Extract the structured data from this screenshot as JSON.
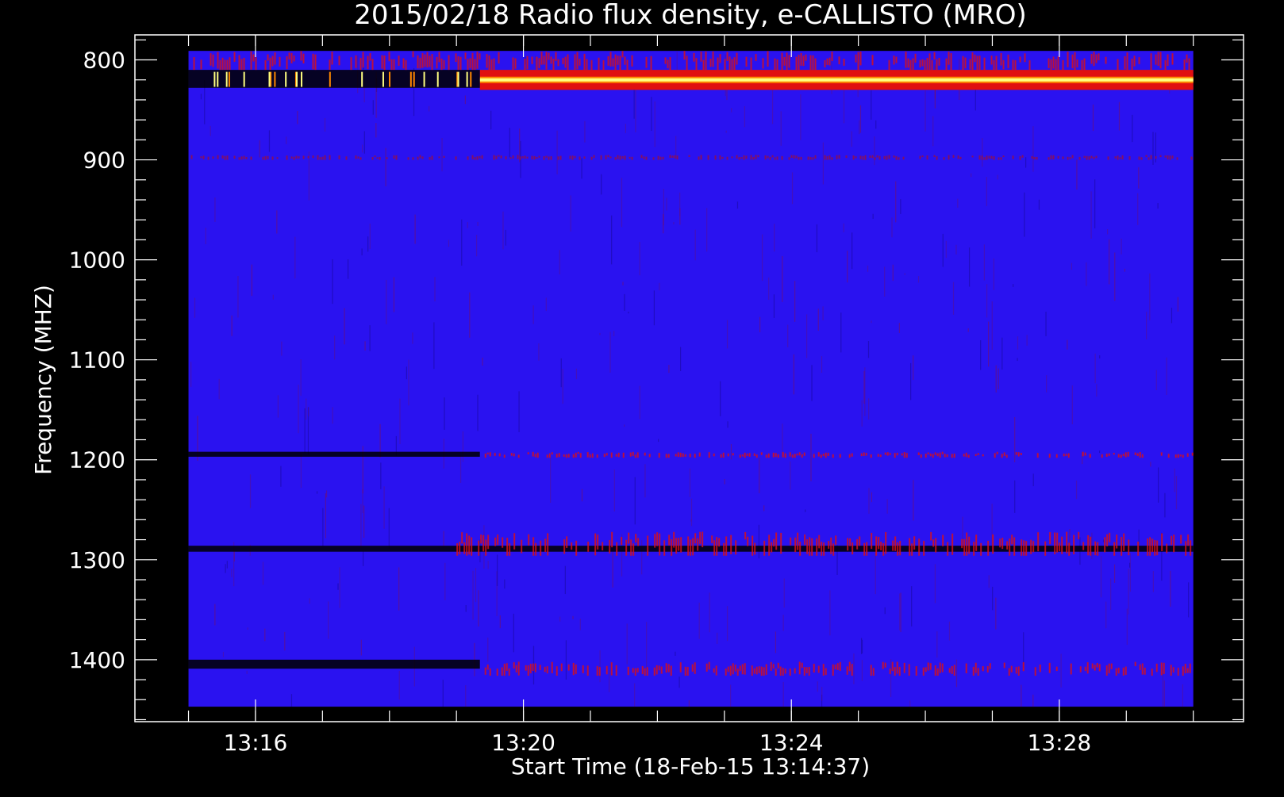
{
  "chart_data": {
    "type": "heatmap",
    "title": "2015/02/18  Radio flux density, e-CALLISTO (MRO)",
    "xlabel": "Start Time (18-Feb-15 13:14:37)",
    "ylabel": "Frequency (MHZ)",
    "x_tick_labels": [
      "13:16",
      "13:20",
      "13:24",
      "13:28"
    ],
    "x_tick_values_min": [
      16,
      20,
      24,
      28
    ],
    "x_minor_tick_values_min": [
      15,
      16,
      17,
      18,
      19,
      20,
      21,
      22,
      23,
      24,
      25,
      26,
      27,
      28,
      29,
      30
    ],
    "xlim_min": [
      14.2,
      30.75
    ],
    "data_x_range_min": [
      15.0,
      30.0
    ],
    "y_tick_labels": [
      "800",
      "900",
      "1000",
      "1100",
      "1200",
      "1300",
      "1400"
    ],
    "y_tick_values": [
      800,
      900,
      1000,
      1100,
      1200,
      1300,
      1400
    ],
    "ylim": [
      775,
      1462
    ],
    "y_inverted": true,
    "data_y_range": [
      791,
      1447
    ],
    "background_color": "#2a12f0",
    "colormap": [
      "#000000",
      "#1a0a8a",
      "#2a12f0",
      "#9a1040",
      "#e01010",
      "#ff8800",
      "#ffff80"
    ],
    "bands": [
      {
        "name": "strong",
        "freq": [
          810,
          830
        ],
        "time_min": [
          19.35,
          30.0
        ],
        "level": 1.0
      },
      {
        "name": "dark",
        "freq": [
          810,
          828
        ],
        "time_min": [
          15.0,
          19.35
        ],
        "level": 0.0
      },
      {
        "name": "top-noise",
        "freq": [
          791,
          810
        ],
        "time_min": [
          15.0,
          30.0
        ],
        "level": 0.45
      },
      {
        "name": "mid-weak",
        "freq": [
          895,
          900
        ],
        "time_min": [
          15.0,
          30.0
        ],
        "level": 0.35
      },
      {
        "name": "dark-1195",
        "freq": [
          1192,
          1197
        ],
        "time_min": [
          15.0,
          19.35
        ],
        "level": 0.0
      },
      {
        "name": "red-1195",
        "freq": [
          1192,
          1198
        ],
        "time_min": [
          19.35,
          30.0
        ],
        "level": 0.5
      },
      {
        "name": "dark-1290",
        "freq": [
          1286,
          1292
        ],
        "time_min": [
          15.0,
          30.0
        ],
        "level": 0.05
      },
      {
        "name": "red-1285",
        "freq": [
          1272,
          1296
        ],
        "time_min": [
          19.0,
          30.0
        ],
        "level": 0.6
      },
      {
        "name": "dark-1405",
        "freq": [
          1400,
          1409
        ],
        "time_min": [
          15.0,
          19.35
        ],
        "level": 0.0
      },
      {
        "name": "red-1405",
        "freq": [
          1402,
          1416
        ],
        "time_min": [
          19.35,
          30.0
        ],
        "level": 0.6
      }
    ]
  }
}
